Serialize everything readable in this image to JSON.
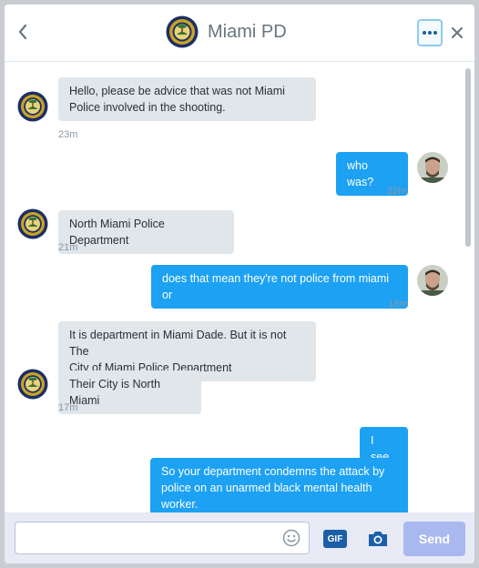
{
  "header": {
    "title": "Miami PD",
    "back_icon": "chevron-left-icon",
    "more_icon": "more-dots-icon",
    "close_icon": "close-icon"
  },
  "messages": [
    {
      "direction": "in",
      "lines": [
        "Hello, please be advice that was not Miami",
        "Police involved  in the shooting."
      ],
      "time": "23m"
    },
    {
      "direction": "out",
      "lines": [
        "who was?"
      ],
      "time": "22m"
    },
    {
      "direction": "in",
      "lines": [
        "North Miami Police Department"
      ],
      "time": "21m"
    },
    {
      "direction": "out",
      "lines": [
        "does that mean they're not police from miami or"
      ],
      "time": "18m"
    },
    {
      "direction": "in",
      "lines": [
        "It is department in Miami Dade. But it is not The",
        "City of Miami Police Department"
      ]
    },
    {
      "direction": "in",
      "lines": [
        "Their City is North Miami"
      ],
      "time": "17m"
    },
    {
      "direction": "out",
      "lines": [
        "I see."
      ]
    },
    {
      "direction": "out",
      "lines": [
        "So your department condemns the attack by",
        "police on an unarmed black mental health",
        "worker."
      ]
    }
  ],
  "composer": {
    "placeholder": "",
    "value": "",
    "gif_label": "GIF",
    "send_label": "Send",
    "emoji_icon": "emoji-icon",
    "photo_icon": "camera-icon"
  },
  "colors": {
    "outgoing_bubble": "#1da1f2",
    "incoming_bubble": "#e1e6ea",
    "send_button": "#aab8f0",
    "composer_background": "#e8eaf6"
  }
}
